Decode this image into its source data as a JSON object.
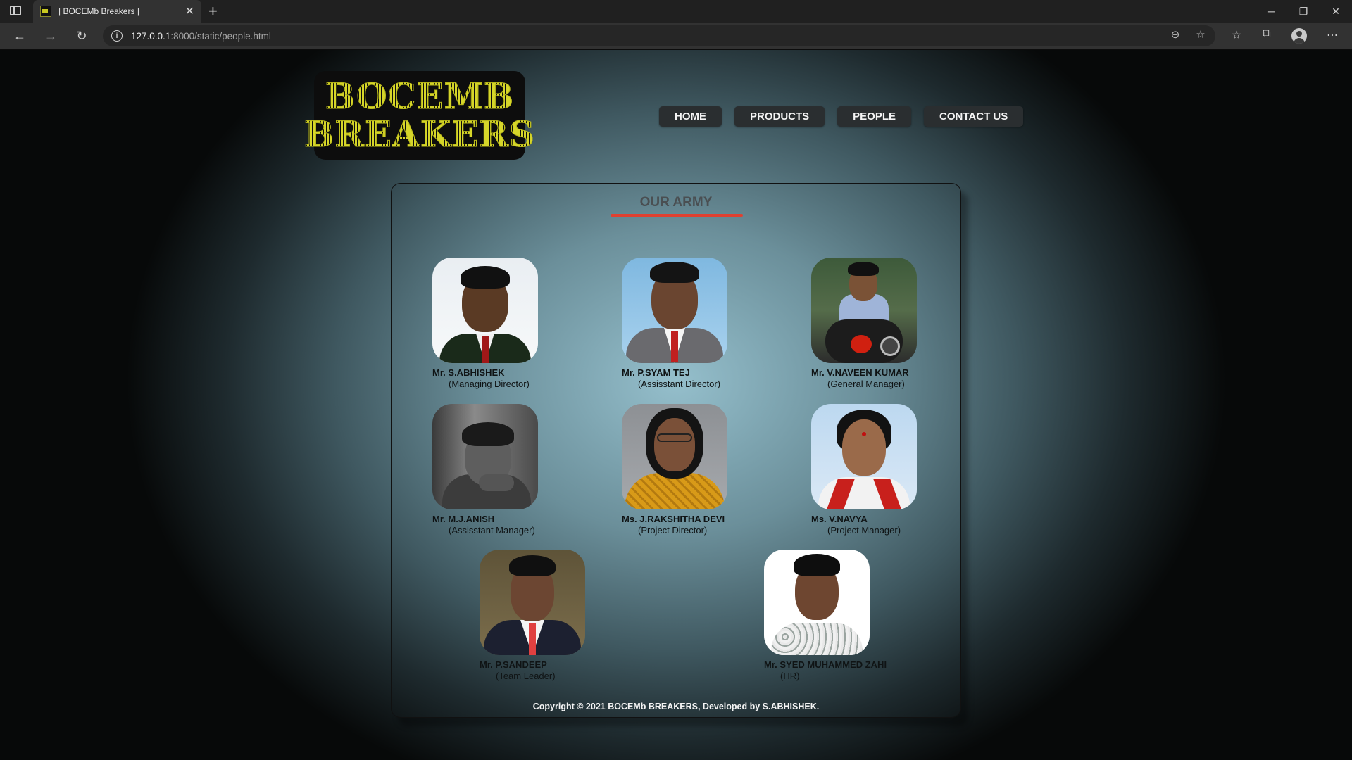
{
  "browser": {
    "tab_title": "| BOCEMb Breakers |",
    "url_host": "127.0.0.1",
    "url_rest": ":8000/static/people.html"
  },
  "site": {
    "logo_line1": "BOCEMB",
    "logo_line2": "BREAKERS",
    "menu": [
      {
        "label": "HOME"
      },
      {
        "label": "PRODUCTS"
      },
      {
        "label": "PEOPLE"
      },
      {
        "label": "CONTACT US"
      }
    ]
  },
  "section": {
    "title": "OUR ARMY"
  },
  "people": [
    {
      "name": "Mr. S.ABHISHEK",
      "role": "(Managing Director)"
    },
    {
      "name": "Mr. P.SYAM TEJ",
      "role": "(Assisstant Director)"
    },
    {
      "name": "Mr. V.NAVEEN KUMAR",
      "role": "(General Manager)"
    },
    {
      "name": "Mr. M.J.ANISH",
      "role": "(Assisstant Manager)"
    },
    {
      "name": "Ms. J.RAKSHITHA DEVI",
      "role": "(Project Director)"
    },
    {
      "name": "Ms. V.NAVYA",
      "role": "(Project Manager)"
    },
    {
      "name": "Mr. P.SANDEEP",
      "role": "(Team Leader)"
    },
    {
      "name": "Mr. SYED MUHAMMED ZAHI",
      "role": "(HR)"
    }
  ],
  "footer": "Copyright © 2021 BOCEMb BREAKERS, Developed by S.ABHISHEK."
}
